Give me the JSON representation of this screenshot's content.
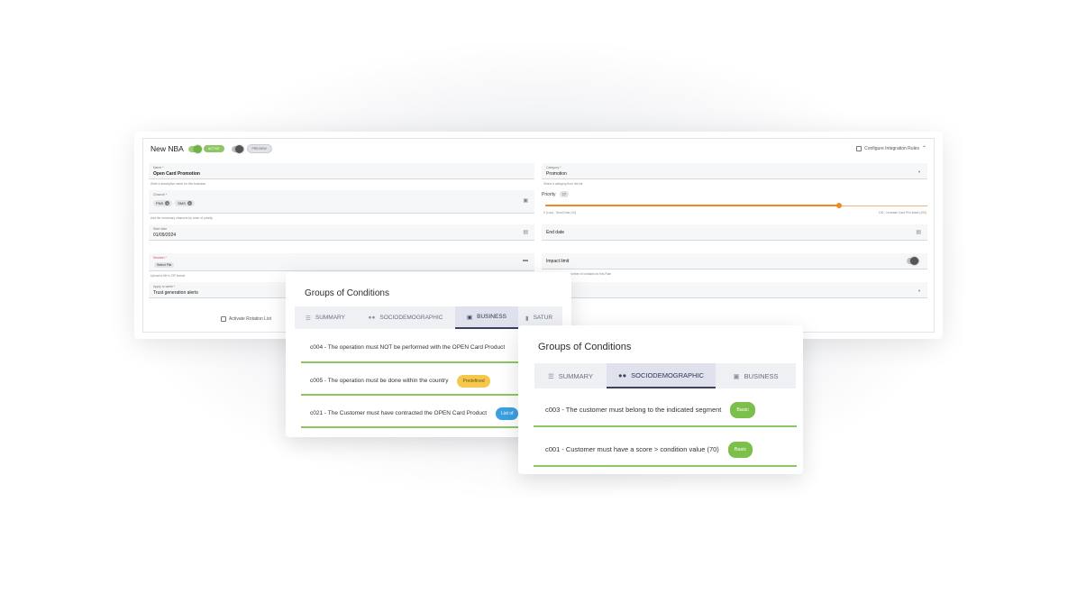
{
  "form": {
    "title": "New NBA",
    "active_label": "ACTIVE",
    "preview_label": "PREVIEW",
    "conf_label": "Configure Integration Rules",
    "name_label": "Name *",
    "name_value": "Open Card Promotion",
    "name_help": "Write a descriptive name for this business",
    "channel_label": "Channel *",
    "channel_chips": [
      "PNS",
      "SMS"
    ],
    "channel_help": "Add the necessary channels by order of priority",
    "start_label": "Start date",
    "start_value": "01/09/2024",
    "session_label": "Session *",
    "select_file_label": "Select File",
    "session_help": "Upload a file in ZIP format",
    "apply_label": "Apply to week *",
    "apply_value": "Trust generation alerts",
    "activate_label": "Activate Rotation List",
    "category_label": "Category *",
    "category_value": "Promotion",
    "category_help": "Select a category from the list",
    "priority_label": "Priority",
    "priority_value": "77",
    "priority_min": "0 (Low) - Send Date (10)",
    "priority_max": "100 - Increase Card Prio ticket (100)",
    "end_label": "End date",
    "impact_label": "Impact limit",
    "impact_help": "Activate to limit the number of contacts for this Rule"
  },
  "card1": {
    "title": "Groups of Conditions",
    "tabs": [
      "SUMMARY",
      "SOCIODEMOGRAPHIC",
      "BUSINESS",
      "SATUR"
    ],
    "conditions": [
      {
        "text": "c004 - The operation must NOT be performed with the OPEN Card Product",
        "badge": ""
      },
      {
        "text": "c005 - The operation must be done within the country",
        "badge": "Predefined"
      },
      {
        "text": "c021 - The Customer must have contracted the OPEN Card Product",
        "badge": "List of"
      }
    ]
  },
  "card2": {
    "title": "Groups of Conditions",
    "tabs": [
      "SUMMARY",
      "SOCIODEMOGRAPHIC",
      "BUSINESS"
    ],
    "conditions": [
      {
        "text": "c003 - The customer must belong to the indicated segment",
        "badge": "Basic"
      },
      {
        "text": "c001 - Customer must have a score > condition value (70)",
        "badge": "Basic"
      }
    ]
  },
  "colors": {
    "accent_green": "#8cc763",
    "slider_orange": "#f08a24",
    "badge_yellow": "#f5c84c",
    "badge_blue": "#3ba1e0"
  }
}
